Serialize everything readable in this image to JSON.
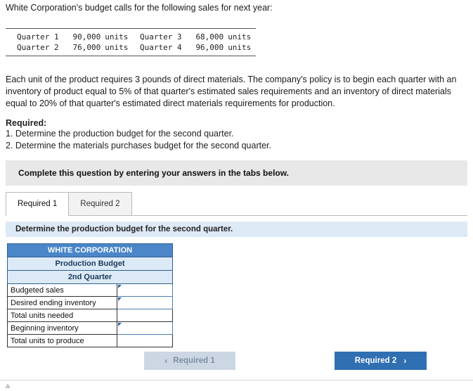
{
  "intro": "White Corporation's budget calls for the following sales for next year:",
  "sales_table": {
    "rows": [
      {
        "label1": "Quarter 1",
        "value1": "90,000",
        "unit1": "units",
        "label2": "Quarter 3",
        "value2": "68,000",
        "unit2": "units"
      },
      {
        "label1": "Quarter 2",
        "value1": "76,000",
        "unit1": "units",
        "label2": "Quarter 4",
        "value2": "96,000",
        "unit2": "units"
      }
    ]
  },
  "paragraph": "Each unit of the product requires 3 pounds of direct materials. The company's policy is to begin each quarter with an inventory of product equal to 5% of that quarter's estimated sales requirements and an inventory of direct materials equal to 20% of that quarter's estimated direct materials requirements for production.",
  "required_heading": "Required:",
  "required_items": [
    "1. Determine the production budget for the second quarter.",
    "2. Determine the materials purchases budget for the second quarter."
  ],
  "banner": "Complete this question by entering your answers in the tabs below.",
  "tabs": [
    {
      "label": "Required 1",
      "active": true
    },
    {
      "label": "Required 2",
      "active": false
    }
  ],
  "tab_description": "Determine the production budget for the second quarter.",
  "budget_table": {
    "title": "WHITE CORPORATION",
    "subtitle1": "Production Budget",
    "subtitle2": "2nd Quarter",
    "rows": [
      {
        "label": "Budgeted sales",
        "value": "",
        "editable": true
      },
      {
        "label": "Desired ending inventory",
        "value": "",
        "editable": true
      },
      {
        "label": "Total units needed",
        "value": "",
        "editable": false
      },
      {
        "label": "Beginning inventory",
        "value": "",
        "editable": true
      },
      {
        "label": "Total units to produce",
        "value": "",
        "editable": false
      }
    ]
  },
  "nav": {
    "prev_label": "Required 1",
    "prev_icon": "chevron-left",
    "next_label": "Required 2",
    "next_icon": "chevron-right"
  },
  "colors": {
    "header_blue": "#4a86c8",
    "subheader_blue": "#dce9f6",
    "tab_desc_blue": "#ddeaf6",
    "next_button": "#2f6fb2",
    "prev_button": "#ccd7e3",
    "banner_gray": "#e8e8e8"
  }
}
